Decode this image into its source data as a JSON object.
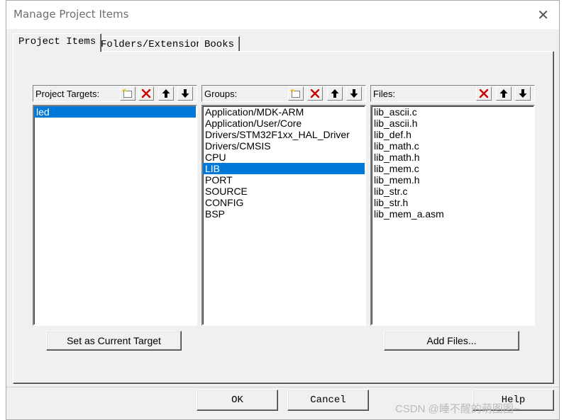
{
  "dialog": {
    "title": "Manage Project Items",
    "close_symbol": "✕"
  },
  "tabs": [
    {
      "label": "Project Items",
      "active": true
    },
    {
      "label": "Folders/Extensions",
      "active": false
    },
    {
      "label": "Books",
      "active": false
    }
  ],
  "targets": {
    "label": "Project Targets:",
    "items": [
      "led"
    ],
    "selected": "led",
    "set_current_label": "Set as Current Target"
  },
  "groups": {
    "label": "Groups:",
    "items": [
      "Application/MDK-ARM",
      "Application/User/Core",
      "Drivers/STM32F1xx_HAL_Driver",
      "Drivers/CMSIS",
      "CPU",
      "LIB",
      "PORT",
      "SOURCE",
      "CONFIG",
      "BSP"
    ],
    "selected": "LIB"
  },
  "files": {
    "label": "Files:",
    "items": [
      "lib_ascii.c",
      "lib_ascii.h",
      "lib_def.h",
      "lib_math.c",
      "lib_math.h",
      "lib_mem.c",
      "lib_mem.h",
      "lib_str.c",
      "lib_str.h",
      "lib_mem_a.asm"
    ],
    "add_files_label": "Add Files..."
  },
  "footer": {
    "ok_label": "OK",
    "cancel_label": "Cancel",
    "help_label": "Help"
  },
  "watermark": "CSDN @睡不醒的萌图图~",
  "colors": {
    "selection": "#0078d7",
    "delete_icon": "#cc0000",
    "dialog_bg": "#f0f0f0"
  },
  "icons": [
    "new-item-icon",
    "delete-icon",
    "move-up-icon",
    "move-down-icon"
  ]
}
